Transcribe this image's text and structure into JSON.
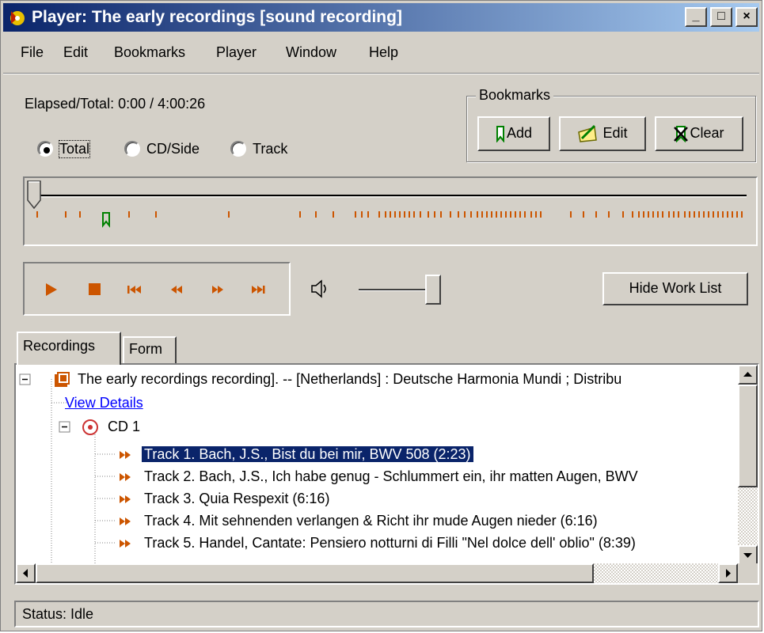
{
  "window": {
    "title": "Player: The early recordings [sound recording]",
    "controls": {
      "minimize": "_",
      "maximize": "□",
      "close": "×"
    }
  },
  "menu": [
    "File",
    "Edit",
    "Bookmarks",
    "Player",
    "Window",
    "Help"
  ],
  "time": {
    "label": "Elapsed/Total:",
    "value": "0:00 / 4:00:26"
  },
  "position_mode": {
    "options": [
      "Total",
      "CD/Side",
      "Track"
    ],
    "selected": "Total"
  },
  "bookmarks": {
    "group_title": "Bookmarks",
    "add": "Add",
    "edit": "Edit",
    "clear": "Clear"
  },
  "timeline": {
    "position": 0
  },
  "transport": {
    "icons": [
      "play-icon",
      "stop-icon",
      "skip-back-icon",
      "rewind-icon",
      "fast-forward-icon",
      "skip-forward-icon"
    ]
  },
  "volume": {
    "level": 0.9
  },
  "hide_work_list": "Hide Work List",
  "tabs": {
    "recordings": "Recordings",
    "form": "Form"
  },
  "tree": {
    "root": "The early recordings recording]. -- [Netherlands] : Deutsche Harmonia Mundi ; Distribu",
    "view_details": "View Details",
    "cd": "CD 1",
    "tracks": [
      "Track 1. Bach, J.S., Bist du bei mir, BWV 508 (2:23)",
      "Track 2. Bach, J.S., Ich habe genug - Schlummert ein, ihr matten Augen, BWV",
      "Track 3. Quia Respexit (6:16)",
      "Track 4. Mit sehnenden verlangen & Richt ihr mude Augen nieder (6:16)",
      "Track 5. Handel, Cantate: Pensiero notturni di Filli \"Nel dolce dell' oblio\" (8:39)"
    ],
    "selected_index": 0
  },
  "status": "Status: Idle",
  "colors": {
    "accent": "#0a246a",
    "icon_orange": "#cc5500",
    "bookmark_green": "#008000",
    "link": "#0000ff"
  }
}
